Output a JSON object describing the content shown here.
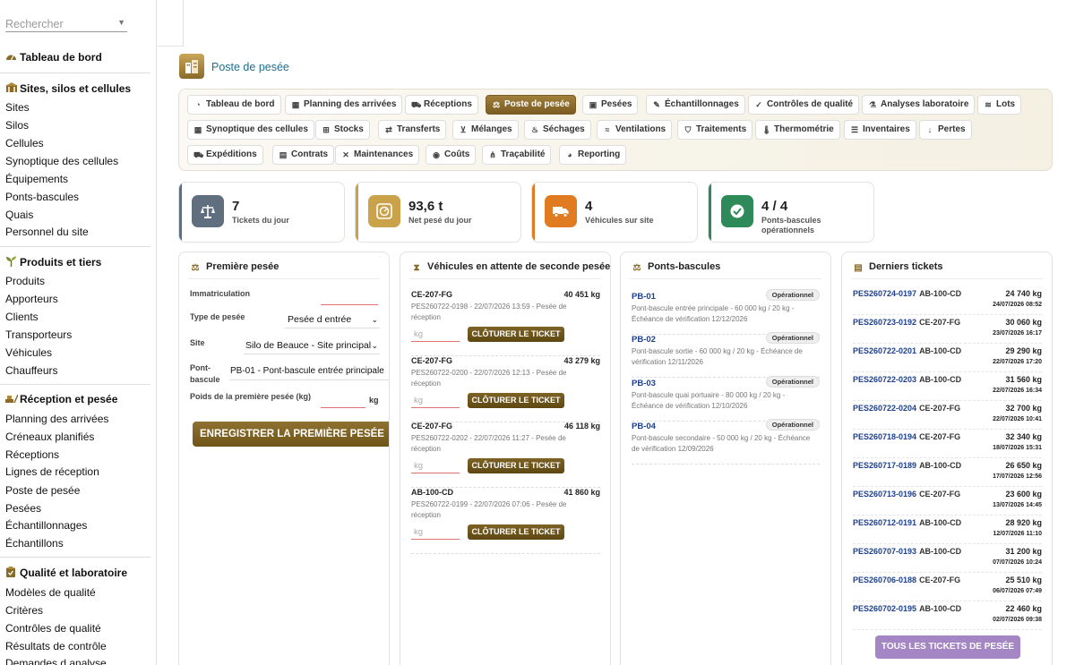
{
  "search": {
    "placeholder": "Rechercher"
  },
  "sidebar": {
    "sections": [
      {
        "title": "Tableau de bord",
        "items": []
      },
      {
        "title": "Sites, silos et cellules",
        "items": [
          "Sites",
          "Silos",
          "Cellules",
          "Synoptique des cellules",
          "Équipements",
          "Ponts-bascules",
          "Quais",
          "Personnel du site"
        ]
      },
      {
        "title": "Produits et tiers",
        "items": [
          "Produits",
          "Apporteurs",
          "Clients",
          "Transporteurs",
          "Véhicules",
          "Chauffeurs"
        ]
      },
      {
        "title": "Réception et pesée",
        "items": [
          "Planning des arrivées",
          "Créneaux planifiés",
          "Réceptions",
          "Lignes de réception",
          "Poste de pesée",
          "Pesées",
          "Échantillonnages",
          "Échantillons"
        ]
      },
      {
        "title": "Qualité et laboratoire",
        "items": [
          "Modèles de qualité",
          "Critères",
          "Contrôles de qualité",
          "Résultats de contrôle",
          "Demandes d analyse"
        ]
      }
    ]
  },
  "page": {
    "title": "Poste de pesée"
  },
  "tabs": [
    [
      "Tableau de bord",
      "Planning des arrivées",
      "Réceptions",
      "Poste de pesée",
      "Pesées",
      "Échantillonnages",
      "Contrôles de qualité",
      "Analyses laboratoire",
      "Lots"
    ],
    [
      "Synoptique des cellules",
      "Stocks",
      "Transferts",
      "Mélanges",
      "Séchages",
      "Ventilations",
      "Traitements",
      "Thermométrie",
      "Inventaires",
      "Pertes"
    ],
    [
      "Expéditions",
      "Contrats",
      "Maintenances",
      "Coûts",
      "Traçabilité",
      "Reporting"
    ]
  ],
  "active_tab": "Poste de pesée",
  "kpis": [
    {
      "value": "7",
      "label": "Tickets du jour",
      "color": "#5f6f80",
      "icon": "scale-icon"
    },
    {
      "value": "93,6 t",
      "label": "Net pesé du jour",
      "color": "#c9a24a",
      "icon": "weight-icon"
    },
    {
      "value": "4",
      "label": "Véhicules sur site",
      "color": "#e07b22",
      "icon": "truck-icon"
    },
    {
      "value": "4 / 4",
      "label": "Ponts-bascules opérationnels",
      "color": "#2f8a5a",
      "icon": "check-circle-icon"
    }
  ],
  "first_weighing": {
    "title": "Première pesée",
    "immat_label": "Immatriculation",
    "type_label": "Type de pesée",
    "type_value": "Pesée d entrée",
    "site_label": "Site",
    "site_value": "Silo de Beauce - Site principal",
    "pont_label_1": "Pont-",
    "pont_label_2": "bascule",
    "pont_value": "PB-01 - Pont-bascule entrée principale",
    "poids_label": "Poids de la première pesée (kg)",
    "kg_unit": "kg",
    "submit": "ENREGISTRER LA PREMIÈRE PESÉE"
  },
  "waiting": {
    "title": "Véhicules en attente de seconde pesée",
    "kg_placeholder": "kg",
    "close_label": "CLÔTURER LE TICKET",
    "items": [
      {
        "plate": "CE-207-FG",
        "weight": "40 451 kg",
        "desc": "PES260722-0198 - 22/07/2026 13:59 - Pesée de réception"
      },
      {
        "plate": "CE-207-FG",
        "weight": "43 279 kg",
        "desc": "PES260722-0200 - 22/07/2026 12:13 - Pesée de réception"
      },
      {
        "plate": "CE-207-FG",
        "weight": "46 118 kg",
        "desc": "PES260722-0202 - 22/07/2026 11:27 - Pesée de réception"
      },
      {
        "plate": "AB-100-CD",
        "weight": "41 860 kg",
        "desc": "PES260722-0199 - 22/07/2026 07:06 - Pesée de réception"
      }
    ]
  },
  "bridges": {
    "title": "Ponts-bascules",
    "items": [
      {
        "code": "PB-01",
        "status": "Opérationnel",
        "desc": "Pont-bascule entrée principale - 60 000 kg / 20 kg - Échéance de vérification 12/12/2026"
      },
      {
        "code": "PB-02",
        "status": "Opérationnel",
        "desc": "Pont-bascule sortie - 60 000 kg / 20 kg - Échéance de vérification 12/11/2026"
      },
      {
        "code": "PB-03",
        "status": "Opérationnel",
        "desc": "Pont-bascule quai portuaire - 80 000 kg / 20 kg - Échéance de vérification 12/10/2026"
      },
      {
        "code": "PB-04",
        "status": "Opérationnel",
        "desc": "Pont-bascule secondaire - 50 000 kg / 20 kg - Échéance de vérification 12/09/2026"
      }
    ]
  },
  "tickets": {
    "title": "Derniers tickets",
    "all_button": "TOUS LES TICKETS DE PESÉE",
    "items": [
      {
        "num": "PES260724-0197",
        "plate": "AB-100-CD",
        "weight": "24 740 kg",
        "date": "24/07/2026 08:52"
      },
      {
        "num": "PES260723-0192",
        "plate": "CE-207-FG",
        "weight": "30 060 kg",
        "date": "23/07/2026 16:17"
      },
      {
        "num": "PES260722-0201",
        "plate": "AB-100-CD",
        "weight": "29 290 kg",
        "date": "22/07/2026 17:20"
      },
      {
        "num": "PES260722-0203",
        "plate": "AB-100-CD",
        "weight": "31 560 kg",
        "date": "22/07/2026 16:34"
      },
      {
        "num": "PES260722-0204",
        "plate": "CE-207-FG",
        "weight": "32 700 kg",
        "date": "22/07/2026 10:41"
      },
      {
        "num": "PES260718-0194",
        "plate": "CE-207-FG",
        "weight": "32 340 kg",
        "date": "18/07/2026 15:31"
      },
      {
        "num": "PES260717-0189",
        "plate": "AB-100-CD",
        "weight": "26 650 kg",
        "date": "17/07/2026 12:56"
      },
      {
        "num": "PES260713-0196",
        "plate": "CE-207-FG",
        "weight": "23 600 kg",
        "date": "13/07/2026 14:45"
      },
      {
        "num": "PES260712-0191",
        "plate": "AB-100-CD",
        "weight": "28 920 kg",
        "date": "12/07/2026 11:10"
      },
      {
        "num": "PES260707-0193",
        "plate": "AB-100-CD",
        "weight": "31 200 kg",
        "date": "07/07/2026 10:24"
      },
      {
        "num": "PES260706-0188",
        "plate": "CE-207-FG",
        "weight": "25 510 kg",
        "date": "06/07/2026 07:49"
      },
      {
        "num": "PES260702-0195",
        "plate": "AB-100-CD",
        "weight": "22 460 kg",
        "date": "02/07/2026 09:38"
      }
    ]
  }
}
